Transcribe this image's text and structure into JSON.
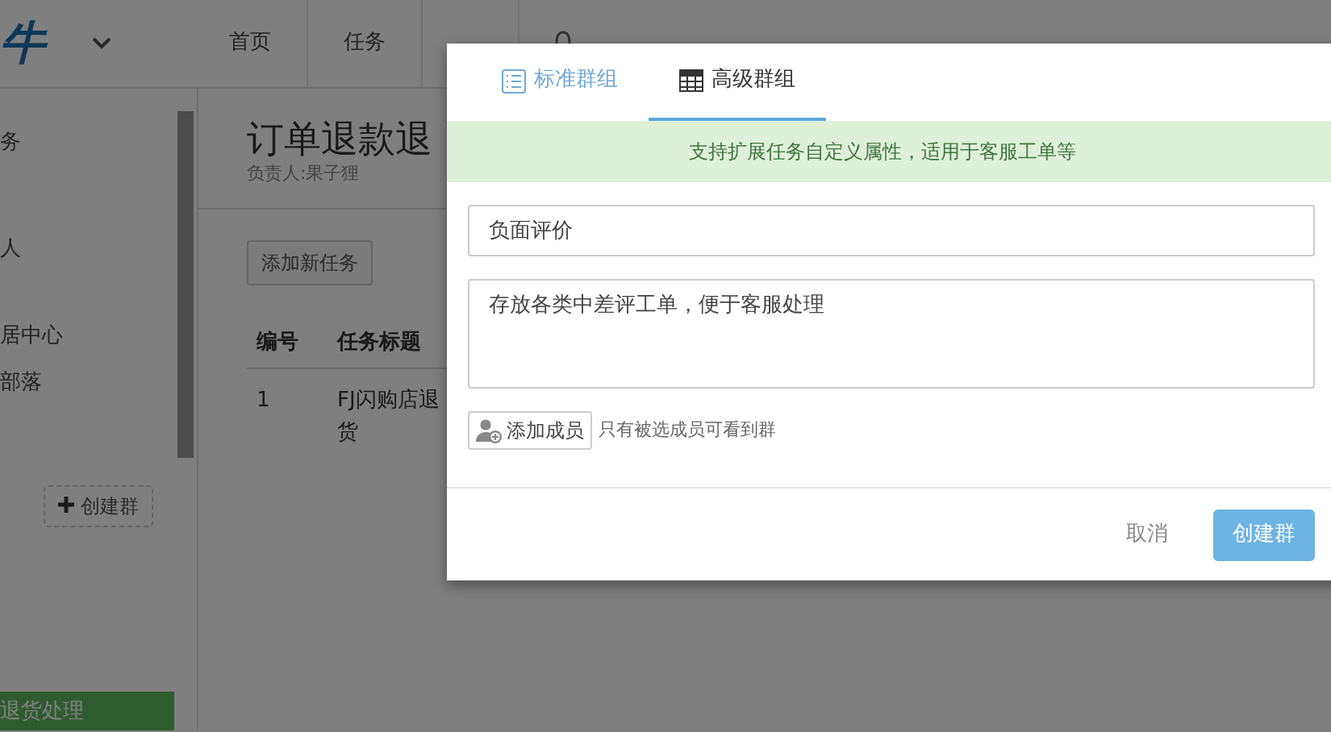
{
  "app": {
    "logo": "牛",
    "nav": [
      {
        "label": "首页"
      },
      {
        "label": "任务"
      }
    ]
  },
  "sidebar": {
    "items": [
      {
        "label": "务",
        "selected": false
      },
      {
        "label": "人",
        "selected": false
      },
      {
        "label": "居中心",
        "selected": false
      },
      {
        "label": "部落",
        "selected": false
      }
    ],
    "create_button": "创建群",
    "active_item": {
      "label": "退货处理",
      "selected": true
    }
  },
  "project": {
    "title": "订单退款退",
    "owner": "负责人:果子狸",
    "add_button": "添加新任务",
    "table": {
      "columns": [
        "编号",
        "任务标题"
      ],
      "rows": [
        [
          "1",
          "FJ闪购店退货"
        ]
      ]
    }
  },
  "dialog": {
    "tabs": [
      {
        "label": "标准群组",
        "selected": false,
        "kind": "list"
      },
      {
        "label": "高级群组",
        "selected": true,
        "kind": "table"
      }
    ],
    "notice": "支持扩展任务自定义属性，适用于客服工单等",
    "name": {
      "value": "负面评价"
    },
    "description": {
      "value": "存放各类中差评工单，便于客服处理"
    },
    "add_member_button": "添加成员",
    "member_hint": "只有被选成员可看到群",
    "cancel": "取消",
    "submit": "创建群"
  }
}
